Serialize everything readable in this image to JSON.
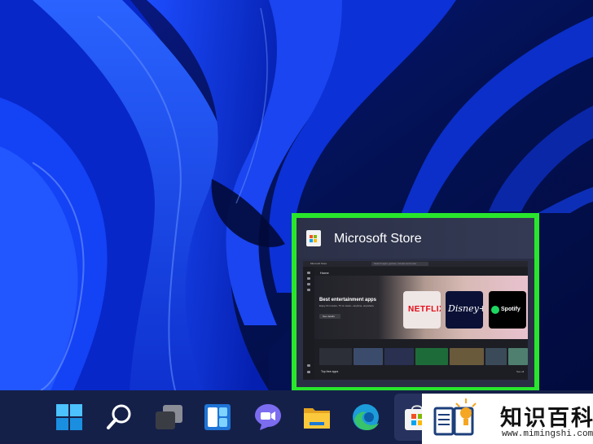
{
  "thumbnail": {
    "app_title": "Microsoft Store",
    "highlight_color": "#29e62c",
    "mini_window": {
      "title": "Microsoft Store",
      "search_placeholder": "Search apps, games, movies and more",
      "page_heading": "Home",
      "hero_title": "Best entertainment apps",
      "hero_subtitle": "Enjoy hit movies, TV & music—anytime, anywhere",
      "hero_button": "See details",
      "tiles": [
        "NETFLIX",
        "Disney+",
        "Spotify"
      ],
      "section_title": "Top free apps",
      "see_all": "See all"
    }
  },
  "taskbar": {
    "icons": [
      "start-icon",
      "search-icon",
      "task-view-icon",
      "widgets-icon",
      "chat-icon",
      "file-explorer-icon",
      "edge-icon",
      "microsoft-store-icon"
    ],
    "active_icon": "microsoft-store-icon"
  },
  "watermark": {
    "name": "知识百科",
    "url": "www.mimingshi.com"
  },
  "colors": {
    "wallpaper_primary": "#0a2fd8",
    "wallpaper_dark": "#00105a",
    "taskbar": "#152049"
  }
}
